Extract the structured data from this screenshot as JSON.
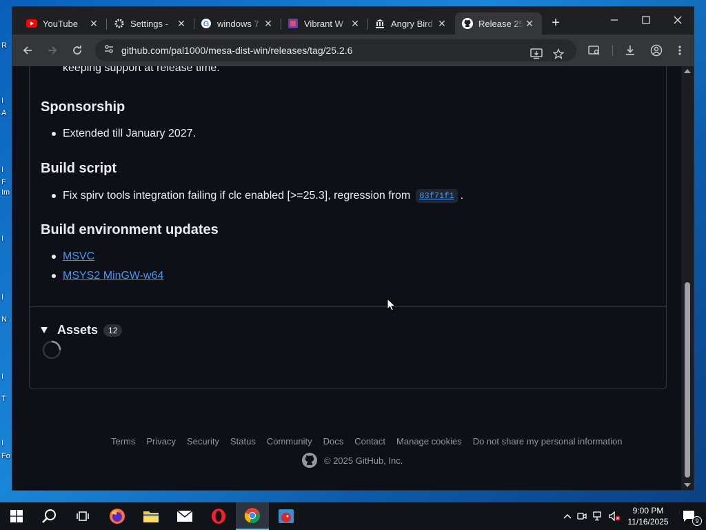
{
  "desktop_fragments": [
    "R",
    "I",
    "A",
    "I",
    "F",
    "Im",
    "I",
    "I",
    "N",
    "I",
    "T",
    "I",
    "Fo"
  ],
  "tabs": [
    {
      "title": "YouTube",
      "icon": "youtube-icon"
    },
    {
      "title": "Settings - ",
      "icon": "gear-icon"
    },
    {
      "title": "windows 7",
      "icon": "google-icon"
    },
    {
      "title": "Vibrant W",
      "icon": "vibrant-icon"
    },
    {
      "title": "Angry Bird",
      "icon": "museum-icon"
    },
    {
      "title": "Release 25",
      "icon": "github-icon",
      "active": true
    }
  ],
  "address_bar": {
    "url": "github.com/pal1000/mesa-dist-win/releases/tag/25.2.6"
  },
  "content": {
    "cut_text": "keeping support at release time.",
    "sponsorship": {
      "heading": "Sponsorship",
      "item": "Extended till January 2027."
    },
    "build_script": {
      "heading": "Build script",
      "item_text": "Fix spirv tools integration failing if clc enabled [>=25.3], regression from",
      "commit": "83f71f1",
      "item_end": "."
    },
    "build_env": {
      "heading": "Build environment updates",
      "links": [
        "MSVC",
        "MSYS2 MinGW-w64"
      ]
    },
    "assets": {
      "label": "Assets",
      "count": "12"
    }
  },
  "footer": {
    "links": [
      "Terms",
      "Privacy",
      "Security",
      "Status",
      "Community",
      "Docs",
      "Contact",
      "Manage cookies",
      "Do not share my personal information"
    ],
    "copyright": "© 2025 GitHub, Inc."
  },
  "taskbar": {
    "time": "9:00 PM",
    "date": "11/16/2025",
    "notification_count": "9"
  },
  "colors": {
    "link": "#4493f8",
    "page_bg": "#0d1117",
    "text": "#e6edf3",
    "muted": "#9198a1"
  }
}
